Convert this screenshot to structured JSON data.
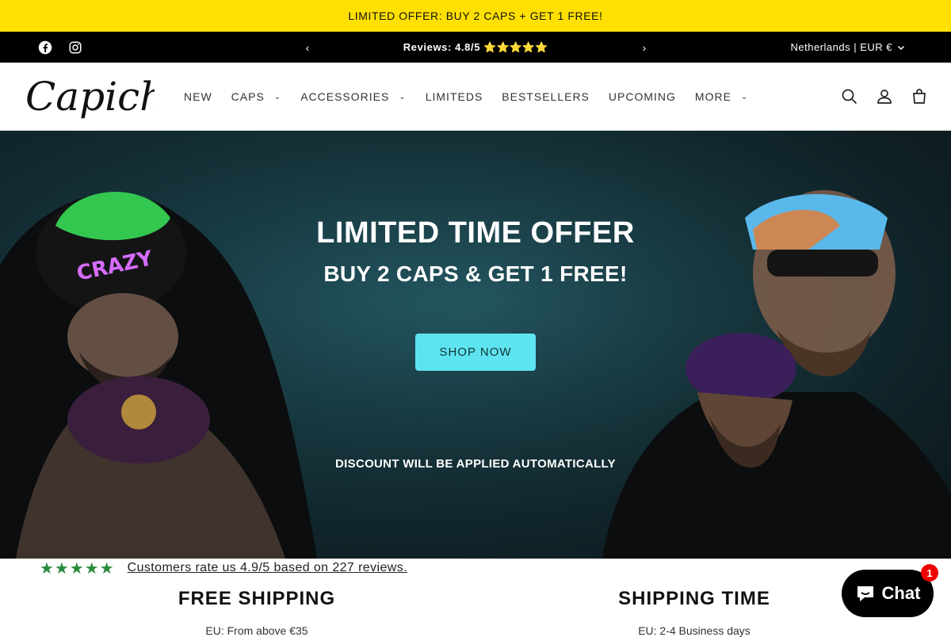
{
  "promo": {
    "text": "LIMITED OFFER: BUY 2 CAPS + GET 1 FREE!"
  },
  "announcement": {
    "social": [
      "facebook-icon",
      "instagram-icon"
    ],
    "prev": "‹",
    "next": "›",
    "text": "Reviews: 4.8/5",
    "stars": "⭐⭐⭐⭐⭐",
    "localization": "Netherlands | EUR €"
  },
  "header": {
    "logo_text": "Capiche",
    "nav": [
      {
        "label": "NEW",
        "dropdown": false
      },
      {
        "label": "CAPS",
        "dropdown": true
      },
      {
        "label": "ACCESSORIES",
        "dropdown": true
      },
      {
        "label": "LIMITEDS",
        "dropdown": false
      },
      {
        "label": "BESTSELLERS",
        "dropdown": false
      },
      {
        "label": "UPCOMING",
        "dropdown": false
      },
      {
        "label": "MORE",
        "dropdown": true
      }
    ],
    "icons": [
      "search-icon",
      "account-icon",
      "cart-icon"
    ]
  },
  "hero": {
    "title": "LIMITED TIME OFFER",
    "subtitle": "BUY 2 CAPS & GET 1 FREE!",
    "button": "SHOP NOW",
    "note": "DISCOUNT WILL BE APPLIED AUTOMATICALLY",
    "cap_text": "CRAZY"
  },
  "reviews": {
    "stars": "★★★★★",
    "text": "Customers rate us 4.9/5 based on 227 reviews."
  },
  "features": [
    {
      "title": "FREE SHIPPING",
      "text": "EU: From above €35"
    },
    {
      "title": "SHIPPING TIME",
      "text": "EU: 2-4 Business days"
    }
  ],
  "chat": {
    "label": "Chat",
    "badge": "1"
  },
  "colors": {
    "promo_bg": "#ffe000",
    "button": "#5ee4f0",
    "stars_green": "#2b8a3e"
  }
}
